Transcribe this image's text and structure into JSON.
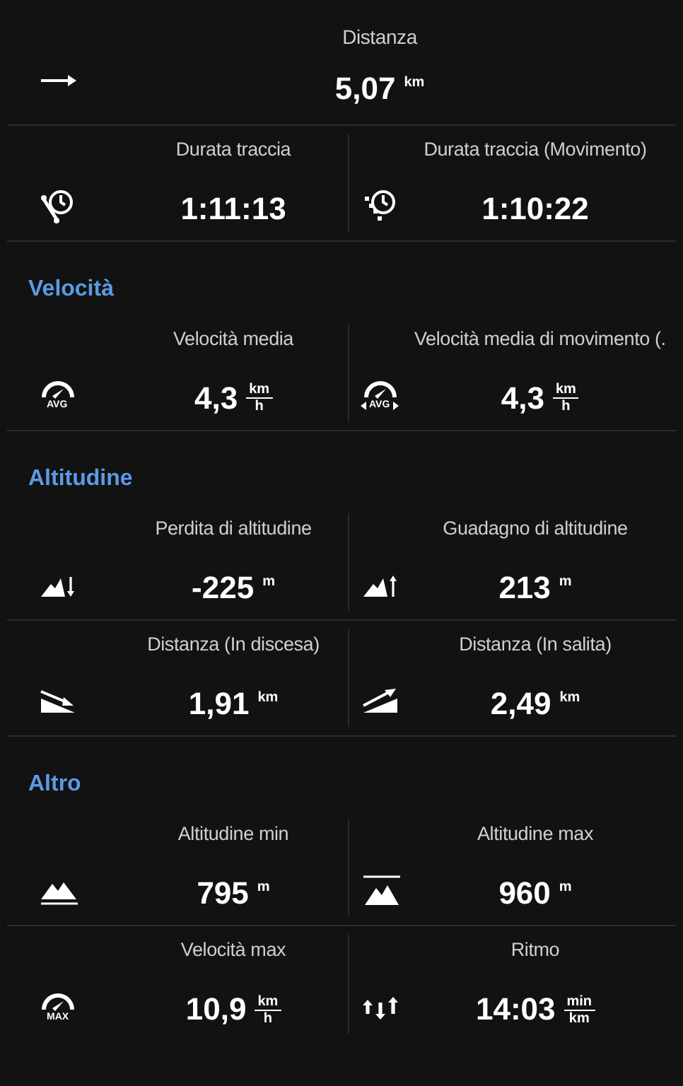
{
  "distance": {
    "label": "Distanza",
    "value": "5,07",
    "unit": "km",
    "kind": "arrow"
  },
  "durations": [
    {
      "label": "Durata traccia",
      "value": "1:11:13",
      "kind": "clock"
    },
    {
      "label": "Durata traccia (Movimento)",
      "value": "1:10:22",
      "kind": "clock-moving"
    }
  ],
  "sections": [
    {
      "title": "Velocità",
      "rows": [
        {
          "stats": [
            {
              "label": "Velocità media",
              "value": "4,3",
              "unit_top": "km",
              "unit_bottom": "h",
              "kind": "gauge",
              "icon_caption": "AVG"
            },
            {
              "label": "Velocità media di movimento (.",
              "value": "4,3",
              "unit_top": "km",
              "unit_bottom": "h",
              "kind": "gauge-moving",
              "icon_caption": "AVG"
            }
          ]
        }
      ]
    },
    {
      "title": "Altitudine",
      "rows": [
        {
          "stats": [
            {
              "label": "Perdita di altitudine",
              "value": "-225",
              "unit": "m",
              "kind": "mountain-down"
            },
            {
              "label": "Guadagno di altitudine",
              "value": "213",
              "unit": "m",
              "kind": "mountain-up"
            }
          ]
        },
        {
          "stats": [
            {
              "label": "Distanza (In discesa)",
              "value": "1,91",
              "unit": "km",
              "kind": "descent"
            },
            {
              "label": "Distanza (In salita)",
              "value": "2,49",
              "unit": "km",
              "kind": "ascent"
            }
          ]
        }
      ]
    },
    {
      "title": "Altro",
      "rows": [
        {
          "stats": [
            {
              "label": "Altitudine min",
              "value": "795",
              "unit": "m",
              "kind": "mountain-min"
            },
            {
              "label": "Altitudine max",
              "value": "960",
              "unit": "m",
              "kind": "mountain-max"
            }
          ]
        },
        {
          "stats": [
            {
              "label": "Velocità max",
              "value": "10,9",
              "unit_top": "km",
              "unit_bottom": "h",
              "kind": "gauge",
              "icon_caption": "MAX"
            },
            {
              "label": "Ritmo",
              "value": "14:03",
              "unit_top": "min",
              "unit_bottom": "km",
              "kind": "pace"
            }
          ]
        }
      ]
    }
  ]
}
